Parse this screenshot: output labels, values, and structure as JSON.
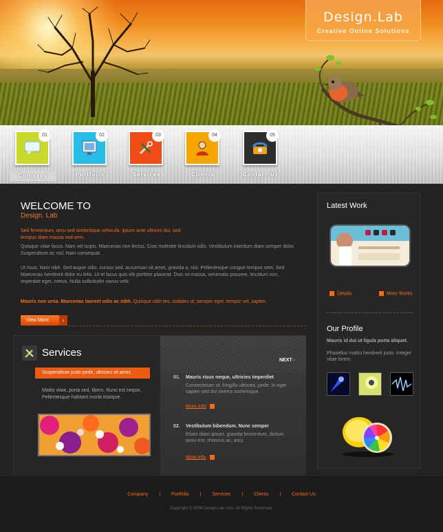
{
  "header": {
    "logo_title": "Design.Lab",
    "logo_tagline": "Creative Online Solutions"
  },
  "nav": {
    "items": [
      {
        "num": "01",
        "label": "Company",
        "color": "#c9d92a",
        "icon": "chat-bubble-icon",
        "active": true
      },
      {
        "num": "02",
        "label": "Portfolio",
        "color": "#27bde8",
        "icon": "monitor-icon"
      },
      {
        "num": "03",
        "label": "Services",
        "color": "#ef4c16",
        "icon": "tools-icon"
      },
      {
        "num": "04",
        "label": "Clients",
        "color": "#f6a500",
        "icon": "person-icon"
      },
      {
        "num": "05",
        "label": "Contact Us",
        "color": "#2e2e2e",
        "icon": "phone-icon"
      }
    ]
  },
  "welcome": {
    "title": "WELCOME TO",
    "subtitle": "Design. Lab",
    "intro_orange": "Sed fermentum, arcu sed scelerisque vehicula, ipsum ante ultrices dui, sed tempus diam massa sed sem.",
    "para1": "Quisque vitae lacus. Nam vel turpis. Maecenas non lectus. Cras molestie tincidunt odio. Vestibulum interdum diam semper dolor. Suspendisse ac nisl. Nam consequat.",
    "para2": "Ut risus. Nam nibh. Sed augue odio, cursus sed, accumsan sit amet, gravida a, nisi. Pellentesque congue tempus sem. Sed Maecenas hendrerit dolor eu felis. Ut et lacus quis elit porttitor placerat. Duis mi massa, venenatis posuere, tincidunt non, imperdiet eget, metus. Nulla sollicitudin varius velit.",
    "bold_lead": "Mauris non urna. Maecenas laoreet odio ac nibh.",
    "bold_rest": " Quisque nibh leo, sodales ut, semper eget, tempor vel, sapien.",
    "view_more": "View More",
    "view_more_arrow": "›"
  },
  "services": {
    "title": "Services",
    "highlight": "Suspendisse justo pede, ultricies sit amet,",
    "text": "Mattis vitae, porta sed, libero. Nunc est neque, Pellentesque habitant morbi tristique.",
    "next": "NEXT",
    "next_arrow": "›",
    "news": [
      {
        "num": "01.",
        "title": "Mauris risus neque, ultricies imperdiet",
        "body": "Consectetuer ut, fringilla ultricies, pede. In eget sapien sed dui viverra scelerisque.",
        "more": "More Info"
      },
      {
        "num": "02.",
        "title": "Vestibulum bibendum. Nunc semper",
        "body": "Etiam diam ipsum, gravida fermentum, dictum posu-ere, rhoncus ac, arcu.",
        "more": "More Info"
      }
    ]
  },
  "sidebar": {
    "latest_work_title": "Latest Work",
    "details": "Details",
    "more_works": "More Works",
    "profile_title": "Our Profile",
    "profile_bold": "Mauris id dui ut ligula porta aliquet.",
    "profile_text": "Phasellus mattis hendrerit justo. Integer vitae lorem."
  },
  "footer": {
    "links": [
      "Company",
      "Portfolio",
      "Services",
      "Clients",
      "Contact Us"
    ],
    "separator": "|",
    "copyright": "Copyright © 2008 Design Lab.com. All Rights Reserved."
  },
  "colors": {
    "accent": "#ff6a12",
    "background": "#232323"
  }
}
